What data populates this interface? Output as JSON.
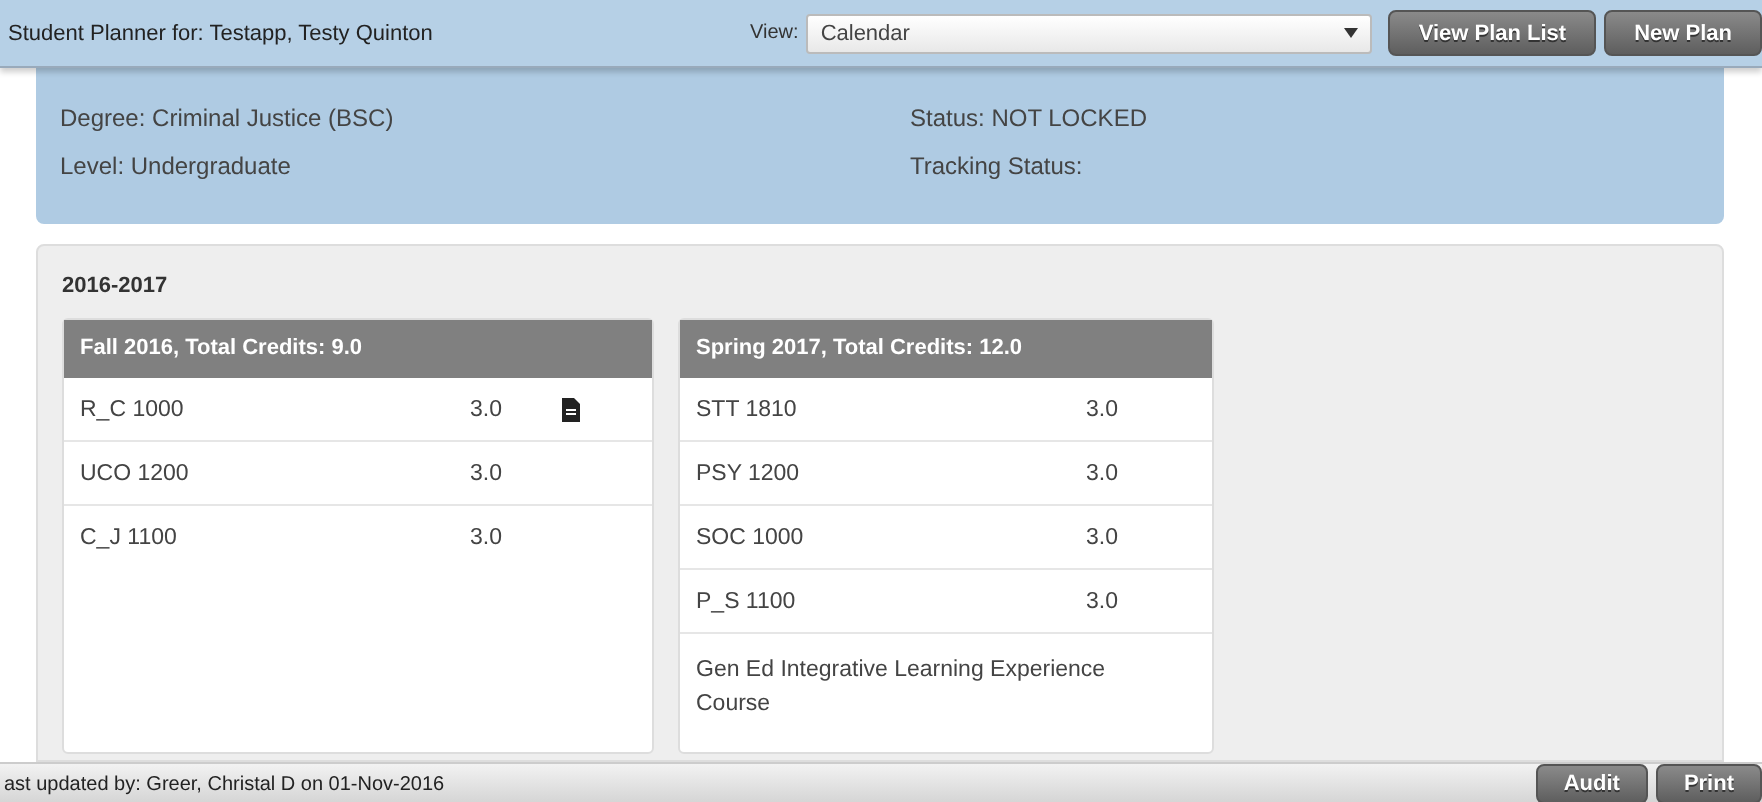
{
  "header": {
    "title": "Student Planner for: Testapp, Testy Quinton",
    "view_label": "View:",
    "view_value": "Calendar",
    "buttons": [
      "View Plan List",
      "New Plan"
    ]
  },
  "info": {
    "left": [
      "Degree: Criminal Justice (BSC)",
      "Level: Undergraduate"
    ],
    "right": [
      "Status: NOT LOCKED",
      "Tracking Status:"
    ]
  },
  "year": {
    "title": "2016-2017",
    "terms": [
      {
        "title": "Fall 2016, Total Credits: 9.0",
        "courses": [
          {
            "code": "R_C 1000",
            "credits": "3.0",
            "has_note": true
          },
          {
            "code": "UCO 1200",
            "credits": "3.0",
            "has_note": false
          },
          {
            "code": "C_J 1100",
            "credits": "3.0",
            "has_note": false
          }
        ]
      },
      {
        "title": "Spring 2017, Total Credits: 12.0",
        "courses": [
          {
            "code": "STT 1810",
            "credits": "3.0",
            "has_note": false
          },
          {
            "code": "PSY 1200",
            "credits": "3.0",
            "has_note": false
          },
          {
            "code": "SOC 1000",
            "credits": "3.0",
            "has_note": false
          },
          {
            "code": "P_S 1100",
            "credits": "3.0",
            "has_note": false
          }
        ],
        "note": "Gen Ed Integrative Learning Experience Course"
      }
    ]
  },
  "footer": {
    "text": "ast updated by: Greer, Christal D on 01-Nov-2016",
    "buttons": [
      "Audit",
      "Print"
    ]
  }
}
